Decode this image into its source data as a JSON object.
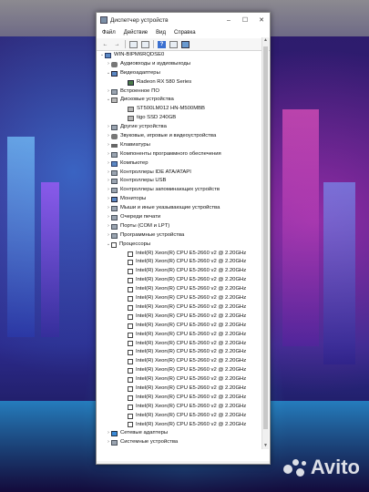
{
  "window": {
    "title": "Диспетчер устройств",
    "controls": {
      "minimize": "–",
      "maximize": "☐",
      "close": "✕"
    }
  },
  "menu": [
    "Файл",
    "Действие",
    "Вид",
    "Справка"
  ],
  "toolbar": {
    "back": "←",
    "forward": "→",
    "help": "?"
  },
  "tree": {
    "root": "WIN-BIPM6RQDSE0",
    "items": [
      {
        "label": "Аудиовходы и аудиовыходы",
        "level": 1,
        "expander": "›",
        "icon": "sound-icon"
      },
      {
        "label": "Видеоадаптеры",
        "level": 1,
        "expander": "⌄",
        "icon": "display-adapter-icon"
      },
      {
        "label": "Radeon RX 580 Series",
        "level": 2,
        "expander": "",
        "icon": "gpu-icon"
      },
      {
        "label": "Встроенное ПО",
        "level": 1,
        "expander": "›",
        "icon": "firmware-icon"
      },
      {
        "label": "Дисковые устройства",
        "level": 1,
        "expander": "⌄",
        "icon": "disk-icon"
      },
      {
        "label": "ST500LM012 HN-M500MBB",
        "level": 2,
        "expander": "",
        "icon": "disk-icon"
      },
      {
        "label": "tigo SSD 240GB",
        "level": 2,
        "expander": "",
        "icon": "disk-icon"
      },
      {
        "label": "Другие устройства",
        "level": 1,
        "expander": "›",
        "icon": "unknown-device-icon"
      },
      {
        "label": "Звуковые, игровые и видеоустройства",
        "level": 1,
        "expander": "›",
        "icon": "sound-icon"
      },
      {
        "label": "Клавиатуры",
        "level": 1,
        "expander": "›",
        "icon": "keyboard-icon"
      },
      {
        "label": "Компоненты программного обеспечения",
        "level": 1,
        "expander": "›",
        "icon": "software-component-icon"
      },
      {
        "label": "Компьютер",
        "level": 1,
        "expander": "›",
        "icon": "computer-icon"
      },
      {
        "label": "Контроллеры IDE ATA/ATAPI",
        "level": 1,
        "expander": "›",
        "icon": "ide-controller-icon"
      },
      {
        "label": "Контроллеры USB",
        "level": 1,
        "expander": "›",
        "icon": "usb-controller-icon"
      },
      {
        "label": "Контроллеры запоминающих устройств",
        "level": 1,
        "expander": "›",
        "icon": "storage-controller-icon"
      },
      {
        "label": "Мониторы",
        "level": 1,
        "expander": "›",
        "icon": "monitor-icon"
      },
      {
        "label": "Мыши и иные указывающие устройства",
        "level": 1,
        "expander": "›",
        "icon": "mouse-icon"
      },
      {
        "label": "Очереди печати",
        "level": 1,
        "expander": "›",
        "icon": "print-queue-icon"
      },
      {
        "label": "Порты (COM и LPT)",
        "level": 1,
        "expander": "›",
        "icon": "ports-icon"
      },
      {
        "label": "Программные устройства",
        "level": 1,
        "expander": "›",
        "icon": "software-device-icon"
      },
      {
        "label": "Процессоры",
        "level": 1,
        "expander": "⌄",
        "icon": "processor-icon"
      },
      {
        "label": "Intel(R) Xeon(R) CPU E5-2660 v2 @ 2.20GHz",
        "level": 2,
        "expander": "",
        "icon": "cpu-icon"
      },
      {
        "label": "Intel(R) Xeon(R) CPU E5-2660 v2 @ 2.20GHz",
        "level": 2,
        "expander": "",
        "icon": "cpu-icon"
      },
      {
        "label": "Intel(R) Xeon(R) CPU E5-2660 v2 @ 2.20GHz",
        "level": 2,
        "expander": "",
        "icon": "cpu-icon"
      },
      {
        "label": "Intel(R) Xeon(R) CPU E5-2660 v2 @ 2.20GHz",
        "level": 2,
        "expander": "",
        "icon": "cpu-icon"
      },
      {
        "label": "Intel(R) Xeon(R) CPU E5-2660 v2 @ 2.20GHz",
        "level": 2,
        "expander": "",
        "icon": "cpu-icon"
      },
      {
        "label": "Intel(R) Xeon(R) CPU E5-2660 v2 @ 2.20GHz",
        "level": 2,
        "expander": "",
        "icon": "cpu-icon"
      },
      {
        "label": "Intel(R) Xeon(R) CPU E5-2660 v2 @ 2.20GHz",
        "level": 2,
        "expander": "",
        "icon": "cpu-icon"
      },
      {
        "label": "Intel(R) Xeon(R) CPU E5-2660 v2 @ 2.20GHz",
        "level": 2,
        "expander": "",
        "icon": "cpu-icon"
      },
      {
        "label": "Intel(R) Xeon(R) CPU E5-2660 v2 @ 2.20GHz",
        "level": 2,
        "expander": "",
        "icon": "cpu-icon"
      },
      {
        "label": "Intel(R) Xeon(R) CPU E5-2660 v2 @ 2.20GHz",
        "level": 2,
        "expander": "",
        "icon": "cpu-icon"
      },
      {
        "label": "Intel(R) Xeon(R) CPU E5-2660 v2 @ 2.20GHz",
        "level": 2,
        "expander": "",
        "icon": "cpu-icon"
      },
      {
        "label": "Intel(R) Xeon(R) CPU E5-2660 v2 @ 2.20GHz",
        "level": 2,
        "expander": "",
        "icon": "cpu-icon"
      },
      {
        "label": "Intel(R) Xeon(R) CPU E5-2660 v2 @ 2.20GHz",
        "level": 2,
        "expander": "",
        "icon": "cpu-icon"
      },
      {
        "label": "Intel(R) Xeon(R) CPU E5-2660 v2 @ 2.20GHz",
        "level": 2,
        "expander": "",
        "icon": "cpu-icon"
      },
      {
        "label": "Intel(R) Xeon(R) CPU E5-2660 v2 @ 2.20GHz",
        "level": 2,
        "expander": "",
        "icon": "cpu-icon"
      },
      {
        "label": "Intel(R) Xeon(R) CPU E5-2660 v2 @ 2.20GHz",
        "level": 2,
        "expander": "",
        "icon": "cpu-icon"
      },
      {
        "label": "Intel(R) Xeon(R) CPU E5-2660 v2 @ 2.20GHz",
        "level": 2,
        "expander": "",
        "icon": "cpu-icon"
      },
      {
        "label": "Intel(R) Xeon(R) CPU E5-2660 v2 @ 2.20GHz",
        "level": 2,
        "expander": "",
        "icon": "cpu-icon"
      },
      {
        "label": "Intel(R) Xeon(R) CPU E5-2660 v2 @ 2.20GHz",
        "level": 2,
        "expander": "",
        "icon": "cpu-icon"
      },
      {
        "label": "Intel(R) Xeon(R) CPU E5-2660 v2 @ 2.20GHz",
        "level": 2,
        "expander": "",
        "icon": "cpu-icon"
      },
      {
        "label": "Сетевые адаптеры",
        "level": 1,
        "expander": "›",
        "icon": "network-adapter-icon"
      },
      {
        "label": "Системные устройства",
        "level": 1,
        "expander": "›",
        "icon": "system-device-icon"
      }
    ]
  },
  "watermark": {
    "text": "Avito"
  }
}
